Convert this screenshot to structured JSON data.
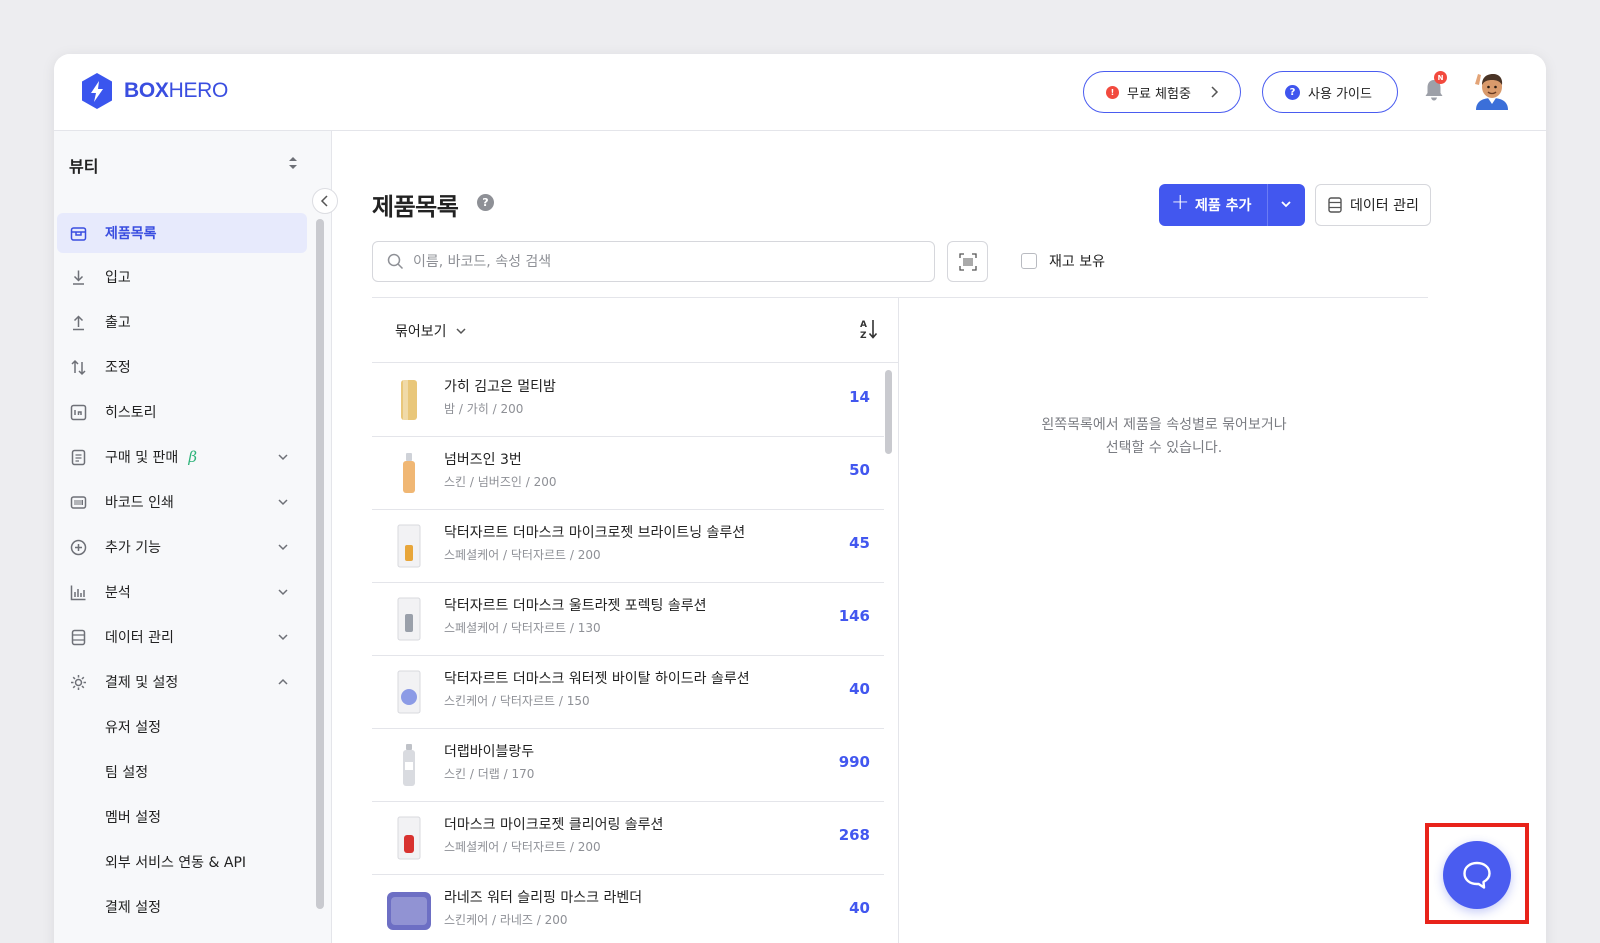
{
  "header": {
    "logo_text_bold": "BOX",
    "logo_text_light": "HERO",
    "trial_label": "무료 체험중",
    "trial_badge": "!",
    "guide_label": "사용 가이드",
    "guide_badge": "?",
    "notification_badge": "N"
  },
  "sidebar": {
    "workspace": "뷰티",
    "items": [
      {
        "label": "제품목록",
        "icon": "box-icon"
      },
      {
        "label": "입고",
        "icon": "arrow-down-icon"
      },
      {
        "label": "출고",
        "icon": "arrow-up-icon"
      },
      {
        "label": "조정",
        "icon": "swap-icon"
      },
      {
        "label": "히스토리",
        "icon": "history-icon"
      },
      {
        "label": "구매 및 판매",
        "icon": "document-icon",
        "badge": "β"
      },
      {
        "label": "바코드 인쇄",
        "icon": "barcode-icon"
      },
      {
        "label": "추가 기능",
        "icon": "plus-circle-icon"
      },
      {
        "label": "분석",
        "icon": "chart-icon"
      },
      {
        "label": "데이터 관리",
        "icon": "database-icon"
      },
      {
        "label": "결제 및 설정",
        "icon": "gear-icon"
      }
    ],
    "sub_items": [
      "유저 설정",
      "팀 설정",
      "멤버 설정",
      "외부 서비스 연동 & API",
      "결제 설정"
    ]
  },
  "main": {
    "title": "제품목록",
    "help": "?",
    "add_button": "제품 추가",
    "data_button": "데이터 관리",
    "search_placeholder": "이름, 바코드, 속성 검색",
    "stock_filter": "재고 보유",
    "group_label": "묶어보기",
    "empty_message_1": "왼쪽목록에서 제품을 속성별로 묶어보거나",
    "empty_message_2": "선택할 수 있습니다."
  },
  "products": [
    {
      "name": "가히 김고은 멀티밤",
      "meta": "밤 / 가히 / 200",
      "qty": "14",
      "color": "#e9c77a"
    },
    {
      "name": "넘버즈인 3번",
      "meta": "스킨 / 넘버즈인 / 200",
      "qty": "50",
      "color": "#f0b774"
    },
    {
      "name": "닥터자르트 더마스크 마이크로젯 브라이트닝 솔루션",
      "meta": "스페셜케어 / 닥터자르트 / 200",
      "qty": "45",
      "color": "#e8a63a"
    },
    {
      "name": "닥터자르트 더마스크 울트라젯 포렉팅 솔루션",
      "meta": "스페셜케어 / 닥터자르트 / 130",
      "qty": "146",
      "color": "#9aa0aa"
    },
    {
      "name": "닥터자르트 더마스크 워터젯 바이탈 하이드라 솔루션",
      "meta": "스킨케어 / 닥터자르트 / 150",
      "qty": "40",
      "color": "#8c9be6"
    },
    {
      "name": "더랩바이블랑두",
      "meta": "스킨 / 더랩 / 170",
      "qty": "990",
      "color": "#d9dbe0"
    },
    {
      "name": "더마스크 마이크로젯 클리어링 솔루션",
      "meta": "스페셜케어 / 닥터자르트 / 200",
      "qty": "268",
      "color": "#d8322f"
    },
    {
      "name": "라네즈 워터 슬리핑 마스크 라벤더",
      "meta": "스킨케어 / 라네즈 / 200",
      "qty": "40",
      "color": "#6d6fc4"
    }
  ]
}
